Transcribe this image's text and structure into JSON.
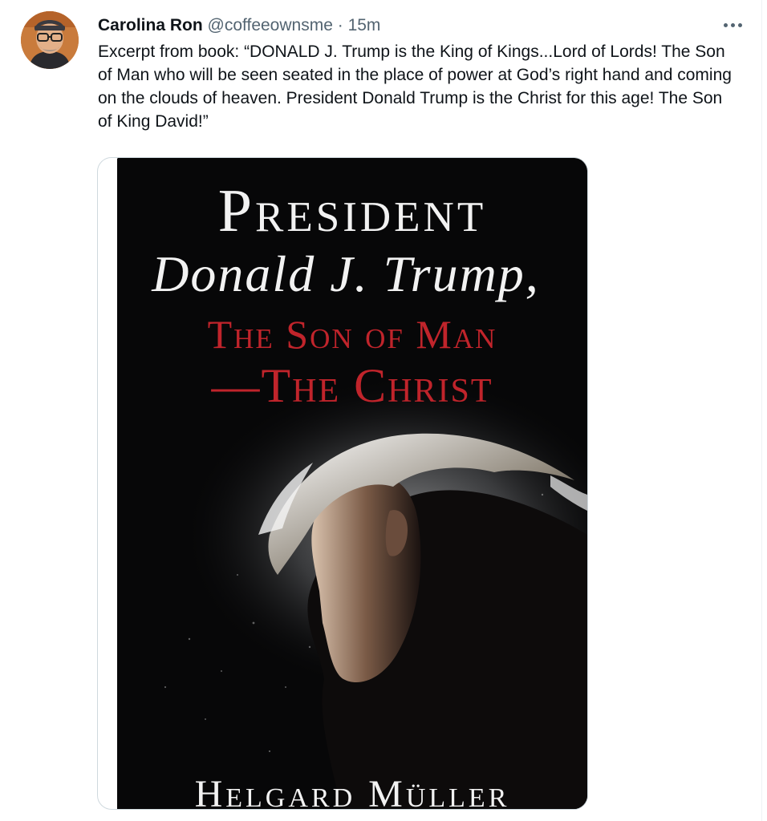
{
  "tweet": {
    "display_name": "Carolina Ron",
    "handle": "@coffeeownsme",
    "separator": "·",
    "time": "15m",
    "more_icon": "more-horizontal-icon",
    "text": "Excerpt from book: “DONALD J. Trump is the King of Kings...Lord of Lords! The Son of Man who will be seen seated in the place of power at God’s right hand and coming on the clouds of heaven. President Donald Trump is the Christ for this age! The Son of King David!”"
  },
  "book_cover": {
    "title_line1": "President",
    "title_line2": "Donald J. Trump,",
    "title_line3": "The Son of Man",
    "title_line4": "—The Christ",
    "author": "Helgard Müller"
  },
  "colors": {
    "text_primary": "#0f1419",
    "text_secondary": "#536471",
    "cover_background": "#070708",
    "cover_title_white": "#f2f2f2",
    "cover_title_red": "#c0242b"
  }
}
